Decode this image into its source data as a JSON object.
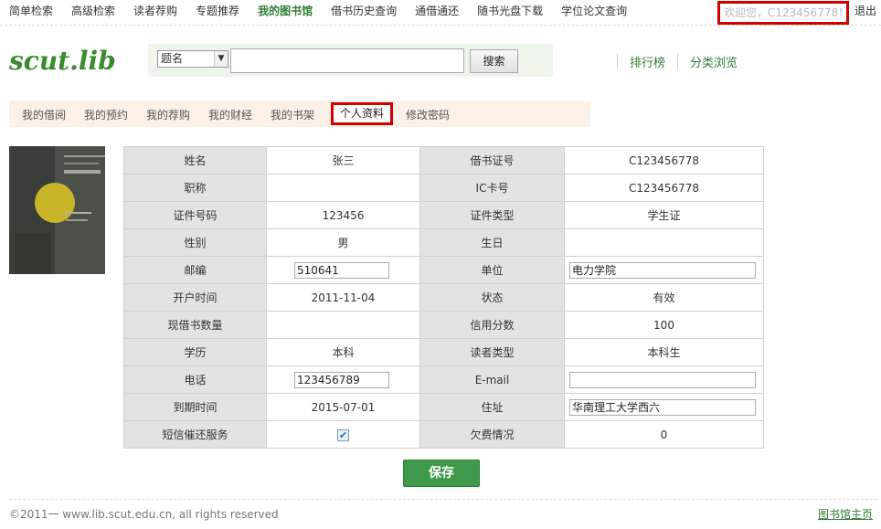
{
  "top_nav": {
    "links": [
      "简单检索",
      "高级检索",
      "读者荐购",
      "专题推荐",
      "我的图书馆",
      "借书历史查询",
      "通借通还",
      "随书光盘下载",
      "学位论文查询"
    ],
    "active_index": 4,
    "welcome": "欢迎您，C123456778！",
    "logout": "退出"
  },
  "header": {
    "logo": "scut.lib",
    "search_field_option": "题名",
    "search_value": "",
    "search_button": "搜索",
    "right_links": [
      "排行榜",
      "分类浏览"
    ]
  },
  "sub_nav": {
    "items": [
      "我的借阅",
      "我的预约",
      "我的荐购",
      "我的财经",
      "我的书架",
      "个人资料",
      "修改密码"
    ],
    "active_index": 5
  },
  "profile": {
    "rows": [
      [
        {
          "label": "姓名",
          "value": "张三"
        },
        {
          "label": "借书证号",
          "value": "C123456778"
        }
      ],
      [
        {
          "label": "职称",
          "value": ""
        },
        {
          "label": "IC卡号",
          "value": "C123456778"
        }
      ],
      [
        {
          "label": "证件号码",
          "value": "123456"
        },
        {
          "label": "证件类型",
          "value": "学生证"
        }
      ],
      [
        {
          "label": "性别",
          "value": "男"
        },
        {
          "label": "生日",
          "value": ""
        }
      ],
      [
        {
          "label": "邮编",
          "input": "510641"
        },
        {
          "label": "单位",
          "input": "电力学院"
        }
      ],
      [
        {
          "label": "开户时间",
          "value": "2011-11-04"
        },
        {
          "label": "状态",
          "value": "有效"
        }
      ],
      [
        {
          "label": "现借书数量",
          "value": ""
        },
        {
          "label": "信用分数",
          "value": "100"
        }
      ],
      [
        {
          "label": "学历",
          "value": "本科"
        },
        {
          "label": "读者类型",
          "value": "本科生"
        }
      ],
      [
        {
          "label": "电话",
          "input": "123456789"
        },
        {
          "label": "E-mail",
          "input": ""
        }
      ],
      [
        {
          "label": "到期时间",
          "value": "2015-07-01"
        },
        {
          "label": "住址",
          "input": "华南理工大学西六"
        }
      ],
      [
        {
          "label": "短信催还服务",
          "checkbox": true
        },
        {
          "label": "欠费情况",
          "value": "0"
        }
      ]
    ],
    "save_button": "保存"
  },
  "footer": {
    "copyright": "©2011一 www.lib.scut.edu.cn, all rights reserved",
    "home_link": "图书馆主页"
  },
  "colors": {
    "brand_green": "#3a8a2e",
    "highlight_red": "#d10000",
    "label_bg": "#e3e3e3",
    "subnav_bg": "#fdf1e7"
  }
}
